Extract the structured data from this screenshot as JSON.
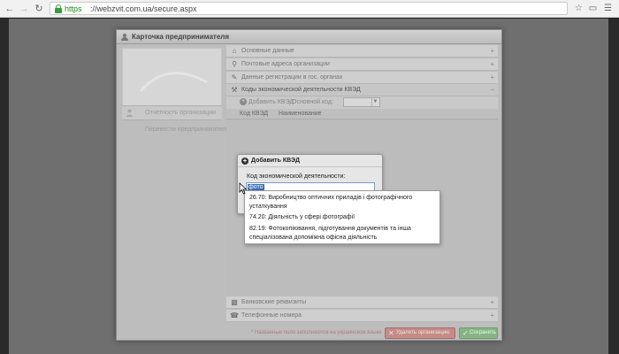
{
  "browser": {
    "url_scheme": "https",
    "url_rest": "://webzvit.com.ua/secure.aspx"
  },
  "modal": {
    "title": "Карточка предпринимателя",
    "left_tabs": [
      {
        "label": "Отчетность организации"
      },
      {
        "label": "Перевести предпринимателя"
      }
    ],
    "sections_top": [
      {
        "label": "Основные данные",
        "toggle": "+"
      },
      {
        "label": "Почтовые адреса организации",
        "toggle": "+"
      },
      {
        "label": "Данные регистрации в гос. органах",
        "toggle": "+"
      },
      {
        "label": "Коды экономической деятельности КВЭД",
        "toggle": "−"
      }
    ],
    "kved_toolbar": {
      "add_label": "Добавить КВЭД",
      "main_code_label": "Основной код:",
      "main_code_value": ""
    },
    "grid_columns": [
      "Код КВЭД",
      "Наименование"
    ],
    "sections_bottom": [
      {
        "label": "Банковские реквизиты",
        "toggle": "+"
      },
      {
        "label": "Телефонные номера",
        "toggle": "+"
      }
    ],
    "footer": {
      "note": "* Названные поля заполняются на украинском языке",
      "delete_label": "Удалить организацию",
      "save_label": "Сохранить"
    }
  },
  "add_dialog": {
    "title": "Добавить КВЭД",
    "field_label": "Код экономической деятельности:",
    "input_value": "фото"
  },
  "autocomplete": {
    "items": [
      {
        "line1": "26.70: Виробництво оптичних приладів і фотографічного",
        "line2": "устаткування"
      },
      {
        "line1": "74.20: Діяльність у сфері фотографії",
        "line2": ""
      },
      {
        "line1": "82.19: Фотокопіювання, підготування документів та інша",
        "line2": "спеціалізована допоміжна офісна діяльність"
      }
    ]
  },
  "colors": {
    "url_green": "#1f8a1f",
    "selection_blue": "#3b6fb6",
    "delete_red": "#c58b86",
    "save_green": "#86b586"
  }
}
